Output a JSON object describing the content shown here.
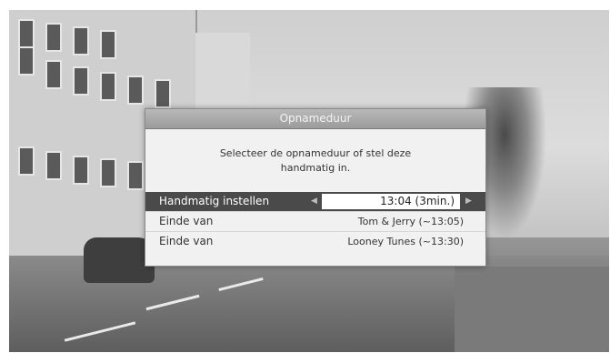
{
  "dialog": {
    "title": "Opnameduur",
    "message_line1": "Selecteer de opnameduur of stel deze",
    "message_line2": "handmatig in.",
    "rows": [
      {
        "label": "Handmatig instellen",
        "value": "13:04 (3min.)",
        "selected": true
      },
      {
        "label": "Einde van",
        "value": "Tom & Jerry (~13:05)",
        "selected": false
      },
      {
        "label": "Einde van",
        "value": "Looney Tunes (~13:30)",
        "selected": false
      }
    ]
  },
  "icons": {
    "left_arrow": "chevron-left-icon",
    "right_arrow": "chevron-right-icon"
  },
  "colors": {
    "selected_row_bg": "#4a4a4a",
    "title_bar_bg": "#a8a8a8"
  }
}
